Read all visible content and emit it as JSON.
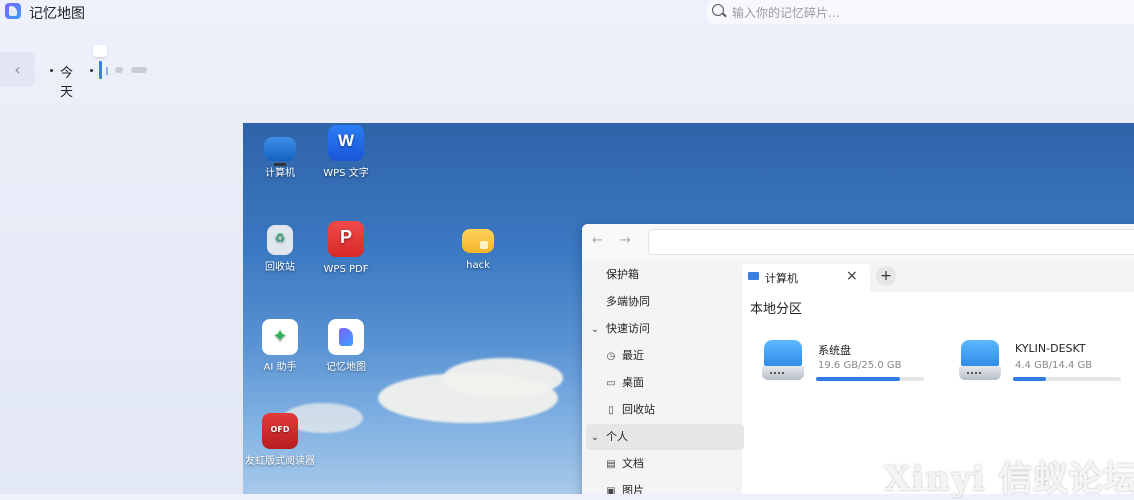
{
  "app": {
    "title": "记忆地图"
  },
  "search": {
    "placeholder": "输入你的记忆碎片..."
  },
  "timeline": {
    "back_label": "‹",
    "today_label": "今天"
  },
  "desktop": {
    "icons": [
      {
        "label": "计算机",
        "icon": "computer-icon"
      },
      {
        "label": "WPS 文字",
        "icon": "wps-writer-icon"
      },
      {
        "label": "回收站",
        "icon": "trash-icon"
      },
      {
        "label": "WPS PDF",
        "icon": "wps-pdf-icon"
      },
      {
        "label": "hack",
        "icon": "folder-icon"
      },
      {
        "label": "AI 助手",
        "icon": "ai-assistant-icon"
      },
      {
        "label": "记忆地图",
        "icon": "memory-map-icon"
      },
      {
        "label": "友虹版式阅读器",
        "icon": "ofd-reader-icon"
      }
    ]
  },
  "file_manager": {
    "nav": {
      "back": "←",
      "forward": "→"
    },
    "sidebar": [
      {
        "label": "保护箱",
        "icon": ""
      },
      {
        "label": "多端协同",
        "icon": ""
      },
      {
        "label": "快速访问",
        "icon": "chevron-down-icon"
      },
      {
        "label": "最近",
        "icon": "clock-icon"
      },
      {
        "label": "桌面",
        "icon": "desktop-icon"
      },
      {
        "label": "回收站",
        "icon": "trash-icon"
      },
      {
        "label": "个人",
        "icon": "chevron-down-icon"
      },
      {
        "label": "文档",
        "icon": "document-icon"
      },
      {
        "label": "图片",
        "icon": "picture-icon"
      }
    ],
    "tab": {
      "label": "计算机",
      "close": "×",
      "add": "+"
    },
    "section_title": "本地分区",
    "drives": [
      {
        "name": "系统盘",
        "size": "19.6 GB/25.0 GB",
        "used_fraction": 0.78
      },
      {
        "name": "KYLIN-DESKT",
        "size": "4.4 GB/14.4 GB",
        "used_fraction": 0.31
      }
    ]
  },
  "watermark": "Xinyi 信蚁论坛"
}
